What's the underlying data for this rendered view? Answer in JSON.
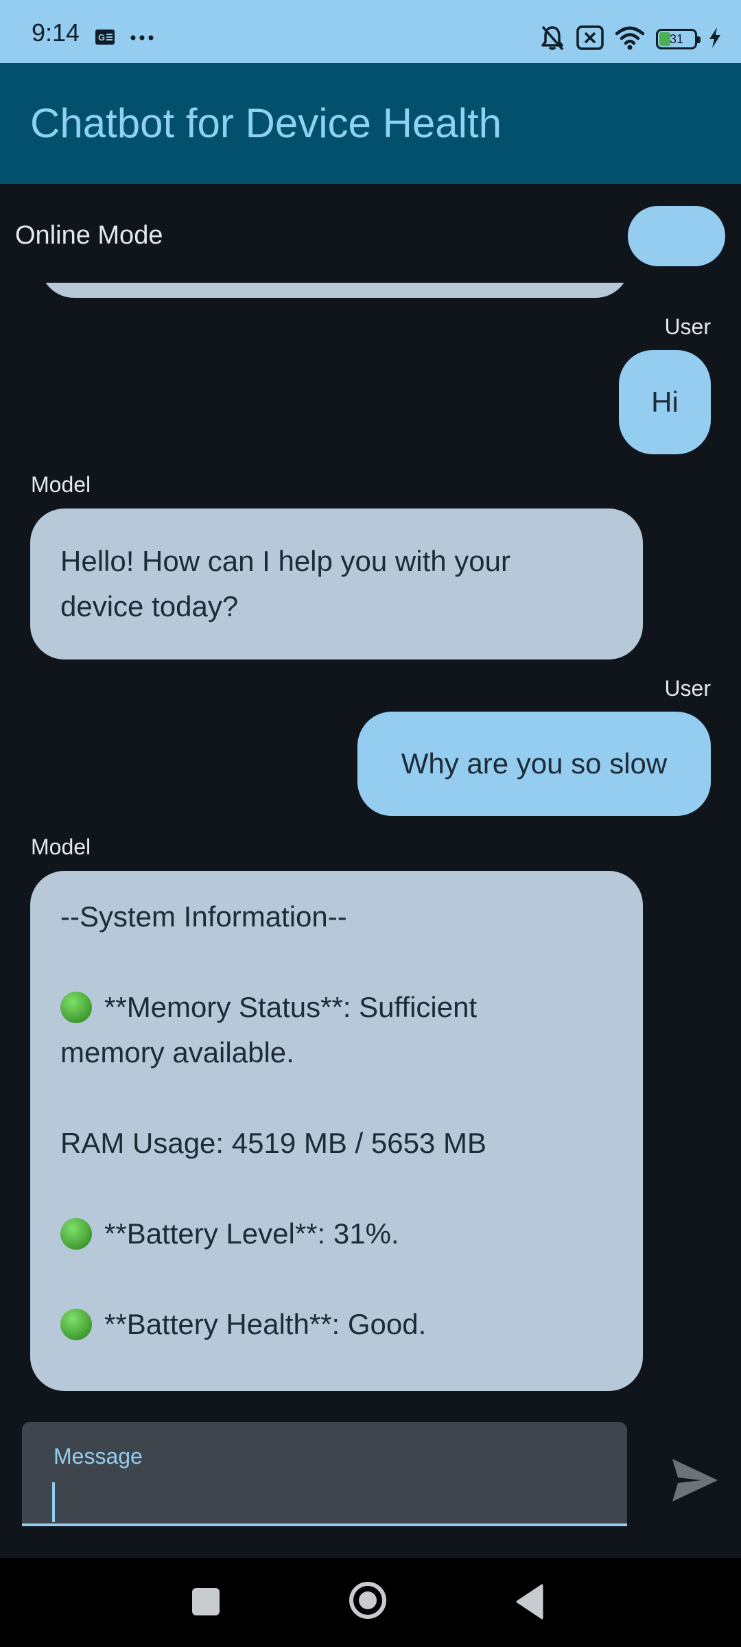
{
  "status_bar": {
    "time": "9:14",
    "notification_icons": [
      "news-icon",
      "more-icon"
    ],
    "system_icons": [
      "bell-off-icon",
      "cancel-box-icon",
      "wifi-icon",
      "battery-icon",
      "charging-bolt-icon"
    ],
    "battery_percent": "31",
    "battery_level": 0.31
  },
  "app_bar": {
    "title": "Chatbot for Device Health"
  },
  "mode": {
    "label": "Online Mode",
    "toggle_on": true
  },
  "messages": [
    {
      "sender": "User",
      "text": "Hi"
    },
    {
      "sender": "Model",
      "lines": [
        "Hello! How can I help you with your",
        "device today?"
      ]
    },
    {
      "sender": "User",
      "text": "Why are you so slow"
    },
    {
      "sender": "Model",
      "lines": [
        "--System Information--",
        "",
        "**Memory Status**: Sufficient",
        "memory available.",
        "",
        "RAM Usage: 4519 MB / 5653 MB",
        "",
        "**Battery Level**: 31%.",
        "",
        "**Battery Health**: Good."
      ]
    }
  ],
  "input": {
    "label": "Message",
    "value": ""
  },
  "nav": {
    "icons": [
      "recent-apps-icon",
      "home-icon",
      "back-icon"
    ]
  },
  "colors": {
    "status_bar": "#95cdf1",
    "app_bar": "#03506d",
    "background": "#10151c",
    "user_bubble": "#95cdf1",
    "model_bubble": "#b7c9d8",
    "accent": "#95cdf1",
    "status_green": "#4caf50"
  }
}
